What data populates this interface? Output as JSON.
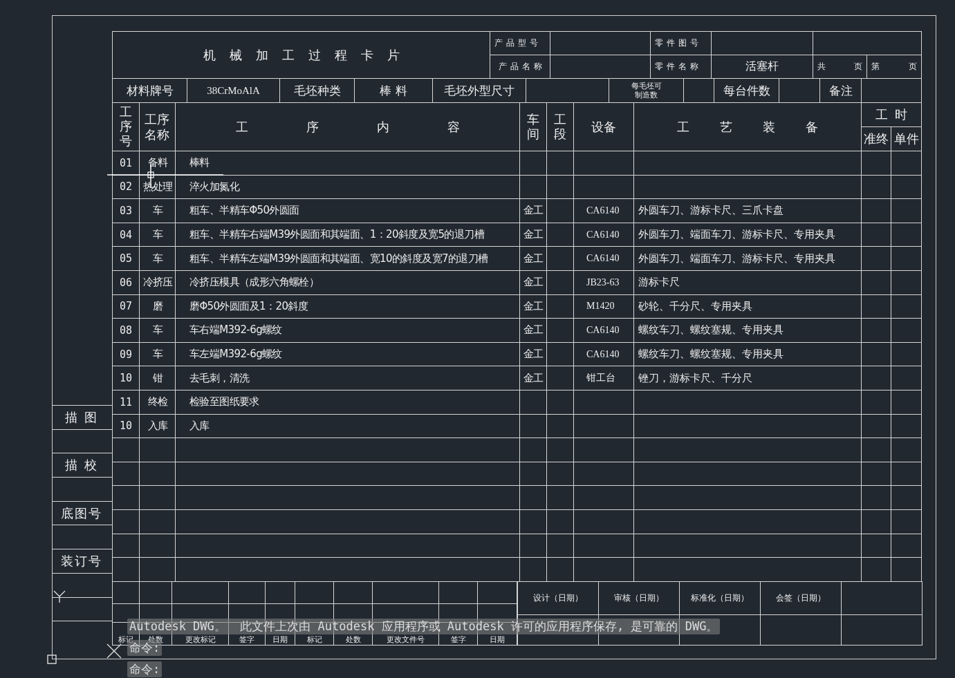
{
  "title": "机械加工过程卡片",
  "header": {
    "product_model_label": "产品型号",
    "product_name_label": "产品名称",
    "part_number_label": "零件图号",
    "part_name_label": "零件名称",
    "part_name": "活塞杆",
    "total_label": "共",
    "total_unit": "页",
    "page_label": "第",
    "page_unit": "页"
  },
  "material_row": {
    "material_label": "材料牌号",
    "material": "38CrMoAlA",
    "blank_type_label": "毛坯种类",
    "blank_type": "棒 料",
    "blank_size_label": "毛坯外型尺寸",
    "pieces_per_blank_label": "每毛坯可制造数",
    "per_unit_label": "每台件数",
    "remarks_label": "备注"
  },
  "columns": {
    "seq": "工序号",
    "name": "工序名称",
    "content": "工序内容",
    "workshop": "车间",
    "section": "工段",
    "equipment": "设备",
    "tooling": "工艺装备",
    "hours": "工时",
    "prep": "准终",
    "unit": "单件"
  },
  "rows": [
    {
      "no": "01",
      "name": "备料",
      "content": "棒料"
    },
    {
      "no": "02",
      "name": "热处理",
      "content": "淬火加氮化"
    },
    {
      "no": "03",
      "name": "车",
      "content": "粗车、半精车Φ50外圆面",
      "workshop": "金工",
      "equipment": "CA6140",
      "tooling": "外圆车刀、游标卡尺、三爪卡盘"
    },
    {
      "no": "04",
      "name": "车",
      "content": "粗车、半精车右端M39外圆面和其端面、1：20斜度及宽5的退刀槽",
      "workshop": "金工",
      "equipment": "CA6140",
      "tooling": "外圆车刀、端面车刀、游标卡尺、专用夹具"
    },
    {
      "no": "05",
      "name": "车",
      "content": "粗车、半精车左端M39外圆面和其端面、宽10的斜度及宽7的退刀槽",
      "workshop": "金工",
      "equipment": "CA6140",
      "tooling": "外圆车刀、端面车刀、游标卡尺、专用夹具"
    },
    {
      "no": "06",
      "name": "冷挤压",
      "content": "冷挤压模具（成形六角螺栓）",
      "workshop": "金工",
      "equipment": "JB23-63",
      "tooling": "游标卡尺"
    },
    {
      "no": "07",
      "name": "磨",
      "content": "磨Φ50外圆面及1：20斜度",
      "workshop": "金工",
      "equipment": "M1420",
      "tooling": "砂轮、千分尺、专用夹具"
    },
    {
      "no": "08",
      "name": "车",
      "content": "车右端M392-6g螺纹",
      "workshop": "金工",
      "equipment": "CA6140",
      "tooling": "螺纹车刀、螺纹塞规、专用夹具"
    },
    {
      "no": "09",
      "name": "车",
      "content": "车左端M392-6g螺纹",
      "workshop": "金工",
      "equipment": "CA6140",
      "tooling": "螺纹车刀、螺纹塞规、专用夹具"
    },
    {
      "no": "10",
      "name": "钳",
      "content": "去毛刺，清洗",
      "workshop": "金工",
      "equipment": "钳工台",
      "tooling": "锉刀，游标卡尺、千分尺"
    },
    {
      "no": "11",
      "name": "终检",
      "content": "检验至图纸要求"
    },
    {
      "no": "10",
      "name": "入库",
      "content": "入库"
    }
  ],
  "change_columns": [
    "标记",
    "处数",
    "更改标记",
    "签字",
    "日期",
    "标记",
    "处数",
    "更改文件号",
    "签字",
    "日期"
  ],
  "signoffs": [
    "设计（日期）",
    "审核（日期）",
    "标准化（日期）",
    "会签（日期）"
  ],
  "binding_strip": [
    "描 图",
    "描 校",
    "底图号",
    "装订号"
  ],
  "command_line": {
    "message": "Autodesk DWG。  此文件上次由 Autodesk 应用程序或 Autodesk 许可的应用程序保存, 是可靠的 DWG。",
    "prompts": [
      "命令:",
      "命令:"
    ]
  }
}
